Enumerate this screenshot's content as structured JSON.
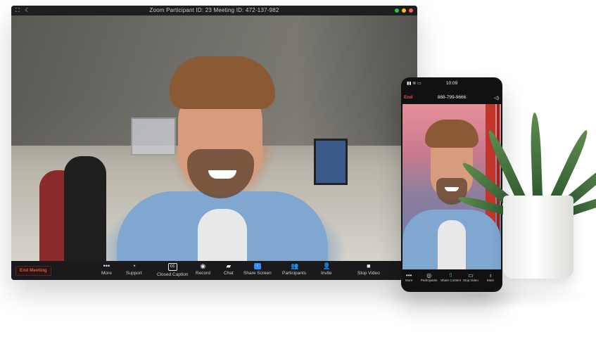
{
  "desktop": {
    "title": "Zoom Participant ID: 23    Meeting ID: 472-137-982",
    "traffic_colors": [
      "#28c840",
      "#febc2e",
      "#ff5f57"
    ],
    "toolbar": {
      "end_meeting": "End Meeting",
      "items": [
        {
          "label": "More",
          "icon": "ellipsis-icon"
        },
        {
          "label": "Support",
          "icon": "support-icon"
        },
        {
          "label": "Closed Caption",
          "icon": "cc-icon"
        },
        {
          "label": "Record",
          "icon": "record-icon"
        },
        {
          "label": "Chat",
          "icon": "chat-icon"
        },
        {
          "label": "Share Screen",
          "icon": "share-screen-icon"
        },
        {
          "label": "Participants",
          "icon": "participants-icon"
        },
        {
          "label": "Invite",
          "icon": "invite-icon"
        },
        {
          "label": "Stop Video",
          "icon": "video-icon"
        }
      ]
    }
  },
  "phone": {
    "time": "10:09",
    "end": "End",
    "meeting_number": "888-799-9666",
    "toolbar": [
      {
        "label": "More",
        "icon": "ellipsis-icon"
      },
      {
        "label": "Participants",
        "icon": "participants-icon"
      },
      {
        "label": "Share Content",
        "icon": "share-icon",
        "active": true
      },
      {
        "label": "Stop Video",
        "icon": "video-icon"
      },
      {
        "label": "Mute",
        "icon": "mic-icon"
      }
    ]
  },
  "colors": {
    "end_red": "#e5533d",
    "share_green": "#3ecf5a",
    "share_blue": "#2d8cff"
  }
}
